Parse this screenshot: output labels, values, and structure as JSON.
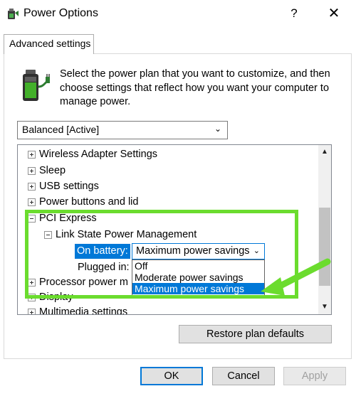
{
  "window": {
    "title": "Power Options",
    "help_label": "?",
    "close_label": "✕"
  },
  "tab": {
    "label": "Advanced settings"
  },
  "header": {
    "description": "Select the power plan that you want to customize, and then choose settings that reflect how you want your computer to manage power."
  },
  "plan_select": {
    "value": "Balanced [Active]"
  },
  "tree": {
    "items": [
      {
        "label": "Wireless Adapter Settings",
        "expanded": false
      },
      {
        "label": "Sleep",
        "expanded": false
      },
      {
        "label": "USB settings",
        "expanded": false
      },
      {
        "label": "Power buttons and lid",
        "expanded": false
      },
      {
        "label": "PCI Express",
        "expanded": true
      },
      {
        "label": "Link State Power Management",
        "expanded": true
      },
      {
        "label": "Processor power m",
        "expanded": false
      },
      {
        "label": "Display",
        "expanded": false
      },
      {
        "label": "Multimedia settings",
        "expanded": false
      }
    ],
    "on_battery_label": "On battery:",
    "plugged_in_label": "Plugged in:",
    "value_select": "Maximum power savings",
    "dropdown_options": [
      "Off",
      "Moderate power savings",
      "Maximum power savings"
    ],
    "selected_option": "Maximum power savings"
  },
  "buttons": {
    "restore": "Restore plan defaults",
    "ok": "OK",
    "cancel": "Cancel",
    "apply": "Apply"
  },
  "icons": {
    "app": "power-options-icon",
    "battery": "battery-plug-icon",
    "help": "help-icon",
    "close": "close-icon",
    "scroll_up": "chevron-up-icon",
    "scroll_down": "chevron-down-icon"
  },
  "colors": {
    "selection": "#0078d7",
    "highlight": "#6bdc2e"
  }
}
